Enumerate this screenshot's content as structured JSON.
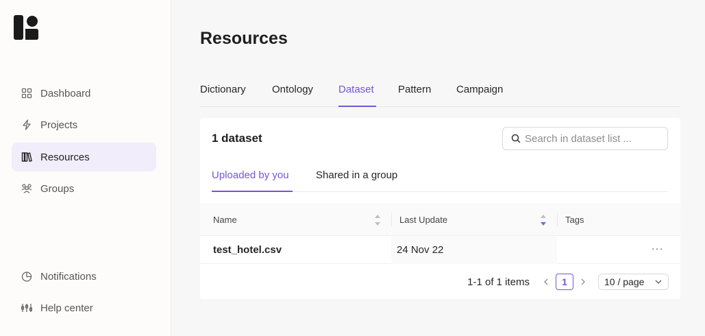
{
  "sidebar": {
    "nav": [
      {
        "label": "Dashboard",
        "icon": "grid-icon"
      },
      {
        "label": "Projects",
        "icon": "lightning-icon"
      },
      {
        "label": "Resources",
        "icon": "books-icon"
      },
      {
        "label": "Groups",
        "icon": "users-icon"
      }
    ],
    "bottom": [
      {
        "label": "Notifications",
        "icon": "pie-chart-icon"
      },
      {
        "label": "Help center",
        "icon": "sliders-icon"
      }
    ],
    "active": "Resources"
  },
  "page": {
    "title": "Resources",
    "tabs": [
      "Dictionary",
      "Ontology",
      "Dataset",
      "Pattern",
      "Campaign"
    ],
    "active_tab": "Dataset"
  },
  "panel": {
    "title": "1 dataset",
    "search_placeholder": "Search in dataset list ...",
    "subtabs": [
      "Uploaded by you",
      "Shared in a group"
    ],
    "active_subtab": "Uploaded by you",
    "columns": [
      "Name",
      "Last Update",
      "Tags"
    ],
    "rows": [
      {
        "name": "test_hotel.csv",
        "last_update": "24 Nov 22",
        "tags": "",
        "actions": "···"
      }
    ],
    "pagination": {
      "info": "1-1 of 1 items",
      "current_page": "1",
      "page_size": "10 / page"
    }
  },
  "colors": {
    "accent": "#7654d9",
    "active_nav_bg": "#f1edfb",
    "sort_active": "#4a7de8"
  }
}
